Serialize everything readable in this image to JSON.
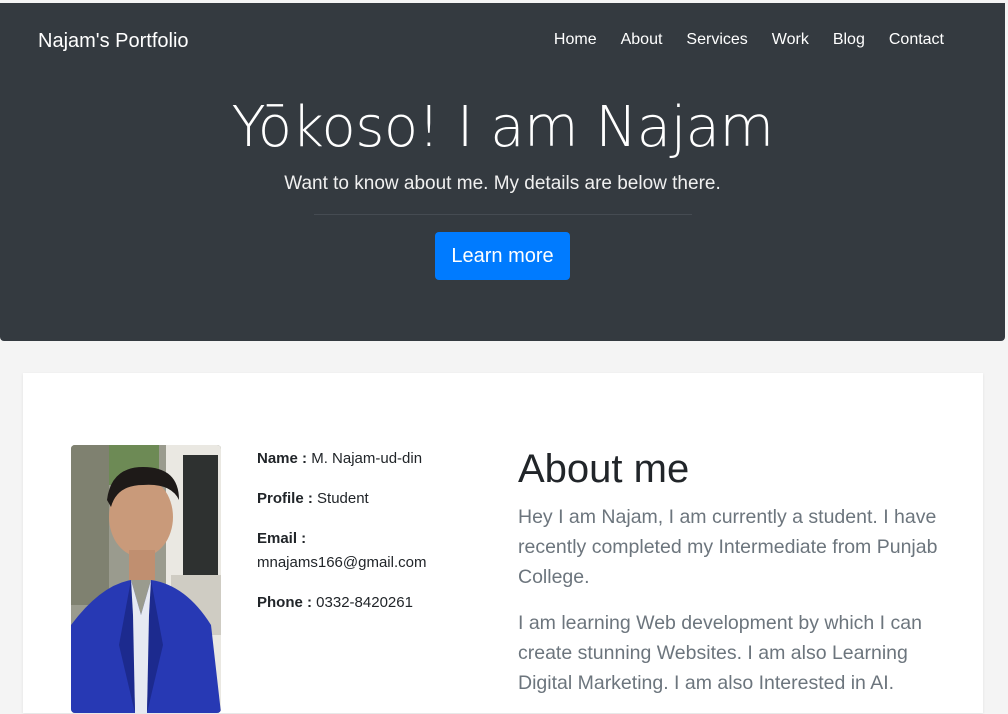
{
  "navbar": {
    "brand": "Najam's Portfolio",
    "links": [
      "Home",
      "About",
      "Services",
      "Work",
      "Blog",
      "Contact"
    ]
  },
  "hero": {
    "title": "Yōkoso! I am Najam",
    "subtitle": "Want to know about me. My details are below there.",
    "button_label": "Learn more"
  },
  "profile": {
    "photo_icon": "profile-photo",
    "name_label": "Name :",
    "name_value": "M. Najam-ud-din",
    "profile_label": "Profile :",
    "profile_value": "Student",
    "email_label": "Email :",
    "email_value": "mnajams166@gmail.com",
    "phone_label": "Phone :",
    "phone_value": "0332-8420261"
  },
  "about": {
    "title": "About me",
    "paragraph1": "Hey I am Najam, I am currently a student. I have recently completed my Intermediate from Punjab College.",
    "paragraph2": "I am learning Web development by which I can create stunning Websites. I am also Learning Digital Marketing. I am also Interested in AI."
  },
  "colors": {
    "hero_bg": "#343a40",
    "accent": "#007bff",
    "page_bg": "#f4f4f4"
  }
}
